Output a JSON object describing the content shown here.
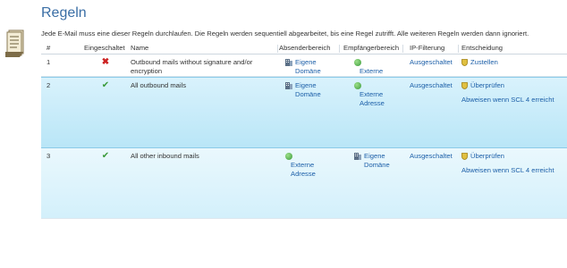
{
  "header": {
    "title": "Regeln",
    "intro": "Jede E-Mail muss eine dieser Regeln durchlaufen. Die Regeln werden sequentiell abgearbeitet, bis eine Regel zutrifft. Alle weiteren Regeln werden dann ignoriert."
  },
  "table": {
    "columns": {
      "num": "#",
      "enabled": "Eingeschaltet",
      "name": "Name",
      "sender": "Absenderbereich",
      "recipient": "Empfängerbereich",
      "ip": "IP-Filterung",
      "decision": "Entscheidung"
    },
    "rows": [
      {
        "num": "1",
        "enabled_mark": "✖",
        "enabled_state": "disabled",
        "name": "Outbound mails without signature and/or encryption",
        "sender": "Eigene Domäne",
        "sender_icon": "domain-icon",
        "recipient": "Externe Adresse",
        "recipient_icon": "globe-icon",
        "ip": "Ausgeschaltet",
        "decision": "Zustellen",
        "decision_detail": ""
      },
      {
        "num": "2",
        "enabled_mark": "✔",
        "enabled_state": "enabled",
        "name": "All outbound mails",
        "sender": "Eigene Domäne",
        "sender_icon": "domain-icon",
        "recipient": "Externe Adresse",
        "recipient_icon": "globe-icon",
        "ip": "Ausgeschaltet",
        "decision": "Überprüfen",
        "decision_detail": "Abweisen wenn SCL 4 erreicht"
      },
      {
        "num": "3",
        "enabled_mark": "✔",
        "enabled_state": "enabled",
        "name": "All other inbound mails",
        "sender": "Externe Adresse",
        "sender_icon": "globe-icon",
        "recipient": "Eigene Domäne",
        "recipient_icon": "domain-icon",
        "ip": "Ausgeschaltet",
        "decision": "Überprüfen",
        "decision_detail": "Abweisen wenn SCL 4 erreicht"
      }
    ]
  },
  "colors": {
    "title": "#3a6ea5",
    "selected_row": "#c7ebf9",
    "disabled": "#cc2222",
    "enabled": "#3a9a3a"
  }
}
